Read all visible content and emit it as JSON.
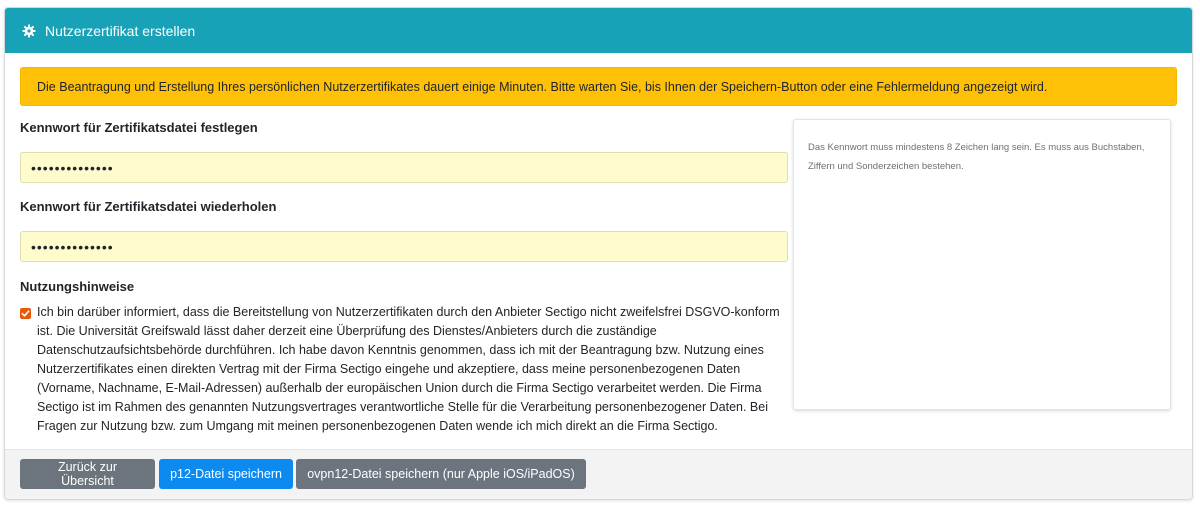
{
  "header": {
    "title": "Nutzerzertifikat erstellen",
    "icon": "gear-icon"
  },
  "alert": {
    "text": "Die Beantragung und Erstellung Ihres persönlichen Nutzerzertifikates dauert einige Minuten. Bitte warten Sie, bis Ihnen der Speichern-Button oder eine Fehlermeldung angezeigt wird.",
    "color": "#ffc107"
  },
  "form": {
    "password": {
      "label": "Kennwort für Zertifikatsdatei festlegen",
      "value": "••••••••••••••"
    },
    "password_repeat": {
      "label": "Kennwort für Zertifikatsdatei wiederholen",
      "value": "••••••••••••••"
    },
    "usage": {
      "heading": "Nutzungshinweise",
      "checked": true,
      "text": "Ich bin darüber informiert, dass die Bereitstellung von Nutzerzertifikaten durch den Anbieter Sectigo nicht zweifelsfrei DSGVO-konform ist. Die Universität Greifswald lässt daher derzeit eine Überprüfung des Dienstes/Anbieters durch die zuständige Datenschutzaufsichtsbehörde durchführen. Ich habe davon Kenntnis genommen, dass ich mit der Beantragung bzw. Nutzung eines Nutzerzertifikates einen direkten Vertrag mit der Firma Sectigo eingehe und akzeptiere, dass meine personenbezogenen Daten (Vorname, Nachname, E-Mail-Adressen) außerhalb der europäischen Union durch die Firma Sectigo verarbeitet werden. Die Firma Sectigo ist im Rahmen des genannten Nutzungsvertrages verantwortliche Stelle für die Verarbeitung personenbezogener Daten. Bei Fragen zur Nutzung bzw. zum Umgang mit meinen personenbezogenen Daten wende ich mich direkt an die Firma Sectigo."
    }
  },
  "help": {
    "text": "Das Kennwort muss mindestens 8 Zeichen lang sein. Es muss aus Buchstaben, Ziffern und Sonderzeichen bestehen."
  },
  "footer": {
    "back_label": "Zurück zur Übersicht",
    "p12_label": "p12-Datei speichern",
    "ovpn12_label": "ovpn12-Datei speichern (nur Apple iOS/iPadOS)"
  },
  "colors": {
    "header": "#17a2b8",
    "primary": "#0d8af0",
    "secondary": "#6c757d",
    "input_bg": "#fefccd"
  }
}
